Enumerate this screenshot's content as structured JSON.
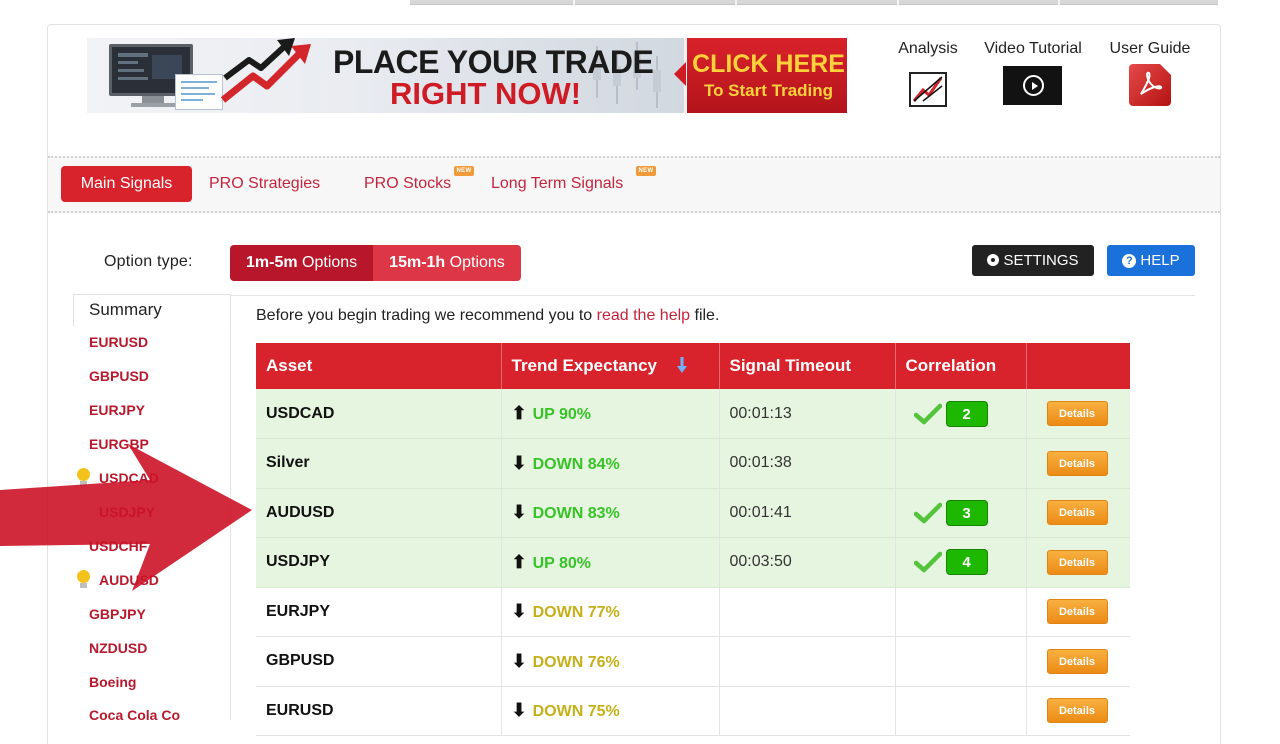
{
  "banner": {
    "headline_line1": "PLACE YOUR TRADE",
    "headline_line2": "RIGHT NOW!",
    "cta_line1": "CLICK HERE",
    "cta_line2": "To Start Trading"
  },
  "tools": {
    "analysis": "Analysis",
    "video_tutorial": "Video Tutorial",
    "user_guide": "User Guide"
  },
  "nav": {
    "tabs": [
      {
        "label": "Main Signals",
        "active": true,
        "new": false
      },
      {
        "label": "PRO Strategies",
        "active": false,
        "new": false
      },
      {
        "label": "PRO Stocks",
        "active": false,
        "new": true
      },
      {
        "label": "Long Term Signals",
        "active": false,
        "new": true
      }
    ],
    "new_badge": "NEW"
  },
  "options": {
    "label": "Option type:",
    "group": [
      {
        "bold": "1m-5m",
        "rest": " Options",
        "selected": true
      },
      {
        "bold": "15m-1h",
        "rest": " Options",
        "selected": false
      }
    ],
    "settings_label": "SETTINGS",
    "help_label": "HELP",
    "help_glyph": "?"
  },
  "sidebar": {
    "summary": "Summary",
    "items": [
      {
        "label": "EURUSD",
        "bulb": false
      },
      {
        "label": "GBPUSD",
        "bulb": false
      },
      {
        "label": "EURJPY",
        "bulb": false
      },
      {
        "label": "EURGBP",
        "bulb": false
      },
      {
        "label": "USDCAD",
        "bulb": true
      },
      {
        "label": "USDJPY",
        "bulb": false
      },
      {
        "label": "USDCHF",
        "bulb": false
      },
      {
        "label": "AUDUSD",
        "bulb": true
      },
      {
        "label": "GBPJPY",
        "bulb": false
      },
      {
        "label": "NZDUSD",
        "bulb": false
      },
      {
        "label": "Boeing",
        "bulb": false
      },
      {
        "label": "Coca Cola Co",
        "bulb": false
      }
    ]
  },
  "intro": {
    "before": "Before you begin trading we recommend you to ",
    "link": "read the help",
    "after": " file."
  },
  "table": {
    "headers": [
      "Asset",
      "Trend Expectancy",
      "Signal Timeout",
      "Correlation",
      ""
    ],
    "details_label": "Details",
    "rows": [
      {
        "asset": "USDCAD",
        "direction": "up",
        "trend": "UP 90%",
        "timeout": "00:01:13",
        "correlation": "2",
        "highlight": true,
        "color": "green"
      },
      {
        "asset": "Silver",
        "direction": "down",
        "trend": "DOWN 84%",
        "timeout": "00:01:38",
        "correlation": "",
        "highlight": true,
        "color": "green"
      },
      {
        "asset": "AUDUSD",
        "direction": "down",
        "trend": "DOWN 83%",
        "timeout": "00:01:41",
        "correlation": "3",
        "highlight": true,
        "color": "green"
      },
      {
        "asset": "USDJPY",
        "direction": "up",
        "trend": "UP 80%",
        "timeout": "00:03:50",
        "correlation": "4",
        "highlight": true,
        "color": "green"
      },
      {
        "asset": "EURJPY",
        "direction": "down",
        "trend": "DOWN 77%",
        "timeout": "",
        "correlation": "",
        "highlight": false,
        "color": "yellow"
      },
      {
        "asset": "GBPUSD",
        "direction": "down",
        "trend": "DOWN 76%",
        "timeout": "",
        "correlation": "",
        "highlight": false,
        "color": "yellow"
      },
      {
        "asset": "EURUSD",
        "direction": "down",
        "trend": "DOWN 75%",
        "timeout": "",
        "correlation": "",
        "highlight": false,
        "color": "yellow"
      }
    ]
  },
  "colors": {
    "brand_red": "#d8222c",
    "trend_green": "#37c327",
    "trend_yellow": "#c5b01a",
    "details_orange": "#f0a030",
    "help_blue": "#1a71da"
  }
}
